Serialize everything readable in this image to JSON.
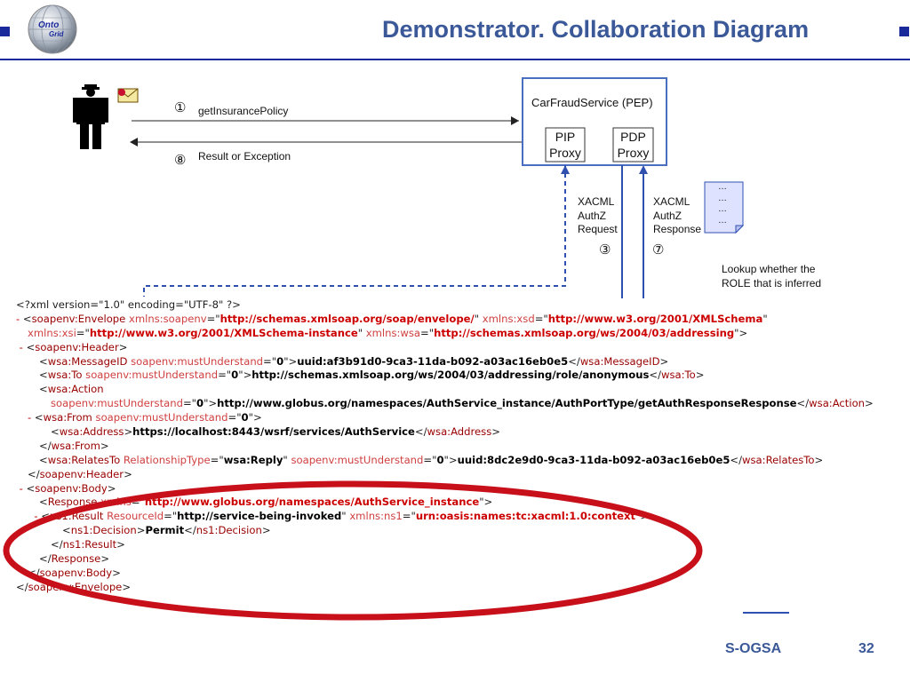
{
  "slide": {
    "title": "Demonstrator. Collaboration Diagram",
    "logo_lines": [
      "Onto",
      "Grid"
    ],
    "footer_name": "S-OGSA",
    "page_number": "32",
    "accent_color": "#3b5998",
    "rule_color": "#1a2a9a"
  },
  "diagram": {
    "step1_num": "①",
    "step1_label": "getInsurancePolicy",
    "step8_num": "⑧",
    "step8_label": "Result or Exception",
    "service_title": "CarFraudService (PEP)",
    "pip_lines": [
      "PIP",
      "Proxy"
    ],
    "pdp_lines": [
      "PDP",
      "Proxy"
    ],
    "request_lines": [
      "XACML",
      "AuthZ",
      "Request"
    ],
    "response_lines": [
      "XACML",
      "AuthZ",
      "Response"
    ],
    "step3_num": "③",
    "step7_num": "⑦",
    "doc_lines": [
      "…",
      "…",
      "…",
      "…"
    ],
    "lookup_lines": [
      "Lookup whether the",
      "ROLE that is inferred"
    ],
    "highlight_color": "#c8101a"
  },
  "xml_lines": [
    {
      "indent": 0,
      "parts": [
        [
          "p",
          "<?xml version=\"1.0\" encoding=\"UTF-8\" ?>"
        ]
      ]
    },
    {
      "indent": 0,
      "parts": [
        [
          "mk",
          "- "
        ],
        [
          "p",
          "<"
        ],
        [
          "t",
          "soapenv:Envelope"
        ],
        [
          "a",
          " xmlns:soapenv"
        ],
        [
          "p",
          "=\""
        ],
        [
          "vr",
          "http://schemas.xmlsoap.org/soap/envelope/"
        ],
        [
          "p",
          "\""
        ],
        [
          "a",
          " xmlns:xsd"
        ],
        [
          "p",
          "=\""
        ],
        [
          "vr",
          "http://www.w3.org/2001/XMLSchema"
        ],
        [
          "p",
          "\""
        ]
      ]
    },
    {
      "indent": 1,
      "parts": [
        [
          "a",
          "xmlns:xsi"
        ],
        [
          "p",
          "=\""
        ],
        [
          "vr",
          "http://www.w3.org/2001/XMLSchema-instance"
        ],
        [
          "p",
          "\""
        ],
        [
          "a",
          " xmlns:wsa"
        ],
        [
          "p",
          "=\""
        ],
        [
          "vr",
          "http://schemas.xmlsoap.org/ws/2004/03/addressing"
        ],
        [
          "p",
          "\">"
        ]
      ]
    },
    {
      "indent": 0,
      "parts": [
        [
          "mk",
          " - "
        ],
        [
          "p",
          "<"
        ],
        [
          "t",
          "soapenv:Header"
        ],
        [
          "p",
          ">"
        ]
      ]
    },
    {
      "indent": 2,
      "parts": [
        [
          "p",
          "<"
        ],
        [
          "t",
          "wsa:MessageID"
        ],
        [
          "a",
          " soapenv:mustUnderstand"
        ],
        [
          "p",
          "=\""
        ],
        [
          "v",
          "0"
        ],
        [
          "p",
          "\">"
        ],
        [
          "x",
          "uuid:af3b91d0-9ca3-11da-b092-a03ac16eb0e5"
        ],
        [
          "p",
          "</"
        ],
        [
          "t",
          "wsa:MessageID"
        ],
        [
          "p",
          ">"
        ]
      ]
    },
    {
      "indent": 2,
      "parts": [
        [
          "p",
          "<"
        ],
        [
          "t",
          "wsa:To"
        ],
        [
          "a",
          " soapenv:mustUnderstand"
        ],
        [
          "p",
          "=\""
        ],
        [
          "v",
          "0"
        ],
        [
          "p",
          "\">"
        ],
        [
          "x",
          "http://schemas.xmlsoap.org/ws/2004/03/addressing/role/anonymous"
        ],
        [
          "p",
          "</"
        ],
        [
          "t",
          "wsa:To"
        ],
        [
          "p",
          ">"
        ]
      ]
    },
    {
      "indent": 2,
      "parts": [
        [
          "p",
          "<"
        ],
        [
          "t",
          "wsa:Action"
        ]
      ]
    },
    {
      "indent": 3,
      "parts": [
        [
          "a",
          "soapenv:mustUnderstand"
        ],
        [
          "p",
          "=\""
        ],
        [
          "v",
          "0"
        ],
        [
          "p",
          "\">"
        ],
        [
          "x",
          "http://www.globus.org/namespaces/AuthService_instance/AuthPortType/getAuthResponseResponse"
        ],
        [
          "p",
          "</"
        ],
        [
          "t",
          "wsa:Action"
        ],
        [
          "p",
          ">"
        ]
      ]
    },
    {
      "indent": 1,
      "parts": [
        [
          "mk",
          "- "
        ],
        [
          "p",
          "<"
        ],
        [
          "t",
          "wsa:From"
        ],
        [
          "a",
          " soapenv:mustUnderstand"
        ],
        [
          "p",
          "=\""
        ],
        [
          "v",
          "0"
        ],
        [
          "p",
          "\">"
        ]
      ]
    },
    {
      "indent": 3,
      "parts": [
        [
          "p",
          "<"
        ],
        [
          "t",
          "wsa:Address"
        ],
        [
          "p",
          ">"
        ],
        [
          "x",
          "https://localhost:8443/wsrf/services/AuthService"
        ],
        [
          "p",
          "</"
        ],
        [
          "t",
          "wsa:Address"
        ],
        [
          "p",
          ">"
        ]
      ]
    },
    {
      "indent": 2,
      "parts": [
        [
          "p",
          "</"
        ],
        [
          "t",
          "wsa:From"
        ],
        [
          "p",
          ">"
        ]
      ]
    },
    {
      "indent": 2,
      "parts": [
        [
          "p",
          "<"
        ],
        [
          "t",
          "wsa:RelatesTo"
        ],
        [
          "a",
          " RelationshipType"
        ],
        [
          "p",
          "=\""
        ],
        [
          "v",
          "wsa:Reply"
        ],
        [
          "p",
          "\""
        ],
        [
          "a",
          " soapenv:mustUnderstand"
        ],
        [
          "p",
          "=\""
        ],
        [
          "v",
          "0"
        ],
        [
          "p",
          "\">"
        ],
        [
          "x",
          "uuid:8dc2e9d0-9ca3-11da-b092-a03ac16eb0e5"
        ],
        [
          "p",
          "</"
        ],
        [
          "t",
          "wsa:RelatesTo"
        ],
        [
          "p",
          ">"
        ]
      ]
    },
    {
      "indent": 1,
      "parts": [
        [
          "p",
          "</"
        ],
        [
          "t",
          "soapenv:Header"
        ],
        [
          "p",
          ">"
        ]
      ]
    },
    {
      "indent": 0,
      "parts": [
        [
          "mk",
          " - "
        ],
        [
          "p",
          "<"
        ],
        [
          "t",
          "soapenv:Body"
        ],
        [
          "p",
          ">"
        ]
      ]
    },
    {
      "indent": 2,
      "parts": [
        [
          "p",
          "<"
        ],
        [
          "t",
          "Response"
        ],
        [
          "a",
          " xmlns"
        ],
        [
          "p",
          "=\""
        ],
        [
          "vr",
          "http://www.globus.org/namespaces/AuthService_instance"
        ],
        [
          "p",
          "\">"
        ]
      ]
    },
    {
      "indent": 1,
      "parts": [
        [
          "mk",
          "  - "
        ],
        [
          "p",
          "<"
        ],
        [
          "t",
          "ns1:Result"
        ],
        [
          "a",
          " ResourceId"
        ],
        [
          "p",
          "=\""
        ],
        [
          "v",
          "http://service-being-invoked"
        ],
        [
          "p",
          "\""
        ],
        [
          "a",
          " xmlns:ns1"
        ],
        [
          "p",
          "=\""
        ],
        [
          "vr",
          "urn:oasis:names:tc:xacml:1.0:context"
        ],
        [
          "p",
          "\">"
        ]
      ]
    },
    {
      "indent": 4,
      "parts": [
        [
          "p",
          "<"
        ],
        [
          "t",
          "ns1:Decision"
        ],
        [
          "p",
          ">"
        ],
        [
          "x",
          "Permit"
        ],
        [
          "p",
          "</"
        ],
        [
          "t",
          "ns1:Decision"
        ],
        [
          "p",
          ">"
        ]
      ]
    },
    {
      "indent": 3,
      "parts": [
        [
          "p",
          "</"
        ],
        [
          "t",
          "ns1:Result"
        ],
        [
          "p",
          ">"
        ]
      ]
    },
    {
      "indent": 2,
      "parts": [
        [
          "p",
          "</"
        ],
        [
          "t",
          "Response"
        ],
        [
          "p",
          ">"
        ]
      ]
    },
    {
      "indent": 1,
      "parts": [
        [
          "p",
          "</"
        ],
        [
          "t",
          "soapenv:Body"
        ],
        [
          "p",
          ">"
        ]
      ]
    },
    {
      "indent": 0,
      "parts": [
        [
          "p",
          "</"
        ],
        [
          "t",
          "soapenv:Envelope"
        ],
        [
          "p",
          ">"
        ]
      ]
    }
  ]
}
